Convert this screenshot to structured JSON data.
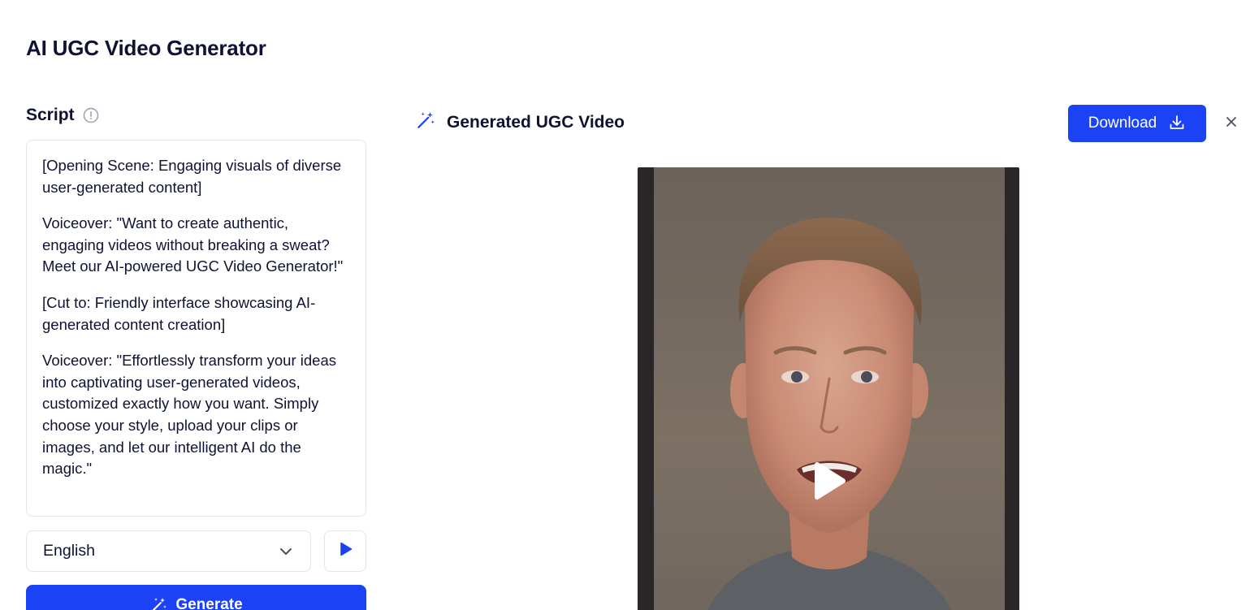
{
  "page": {
    "title": "AI UGC Video Generator"
  },
  "script": {
    "label": "Script",
    "paragraphs": [
      "[Opening Scene: Engaging visuals of diverse user-generated content]",
      "Voiceover: \"Want to create authentic, engaging videos without breaking a sweat? Meet our AI-powered UGC Video Generator!\"",
      "[Cut to: Friendly interface showcasing AI-generated content creation]",
      "Voiceover: \"Effortlessly transform your ideas into captivating user-generated videos, customized exactly how you want. Simply choose your style, upload your clips or images, and let our intelligent AI do the magic.\""
    ]
  },
  "language": {
    "selected": "English"
  },
  "actions": {
    "generate_label": "Generate",
    "download_label": "Download"
  },
  "result": {
    "title": "Generated UGC Video"
  },
  "colors": {
    "accent": "#1b43f5",
    "text": "#0f1232",
    "border": "#e3e5ea"
  },
  "icons": {
    "info": "info-circle-icon",
    "chevron": "chevron-down-icon",
    "play": "play-icon",
    "magic": "magic-wand-icon",
    "download": "download-icon",
    "close": "close-icon"
  }
}
